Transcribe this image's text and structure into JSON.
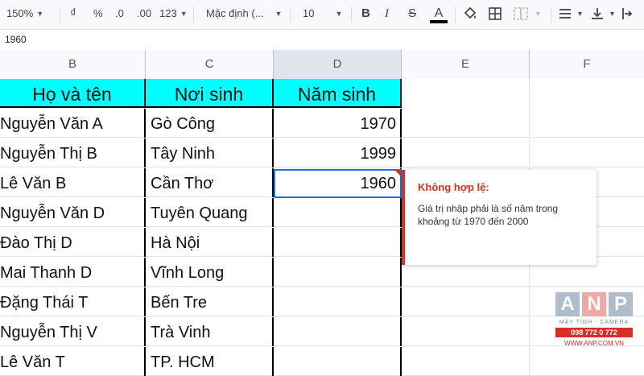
{
  "toolbar": {
    "zoom": "150%",
    "currency": "₫",
    "percent": "%",
    "dec_decrease": ".0",
    "dec_increase": ".00",
    "more_formats": "123",
    "font_name": "Mặc định (...",
    "font_size": "10",
    "bold": "B",
    "italic": "I",
    "strike": "S",
    "text_color": "A"
  },
  "formula_bar": {
    "value": "1960"
  },
  "columns": [
    "B",
    "C",
    "D",
    "E",
    "F"
  ],
  "table": {
    "headers": [
      "Họ và tên",
      "Nơi sinh",
      "Năm sinh"
    ],
    "rows": [
      [
        "Nguyễn Văn A",
        "Gò Công",
        "1970"
      ],
      [
        "Nguyễn Thị B",
        "Tây Ninh",
        "1999"
      ],
      [
        "Lê Văn B",
        "Cần Thơ",
        "1960"
      ],
      [
        "Nguyễn Văn D",
        "Tuyên Quang",
        ""
      ],
      [
        "Đào Thị D",
        "Hà Nội",
        ""
      ],
      [
        "Mai Thanh D",
        "Vĩnh Long",
        ""
      ],
      [
        "Đặng Thái T",
        "Bến Tre",
        ""
      ],
      [
        "Nguyễn Thị V",
        "Trà Vinh",
        ""
      ],
      [
        "Lê Văn T",
        "TP. HCM",
        ""
      ]
    ]
  },
  "tooltip": {
    "title": "Không hợp lệ:",
    "message": "Giá trị nhập phải là số năm trong khoảng từ 1970 đến 2000"
  },
  "logo": {
    "letters": [
      "A",
      "N",
      "P"
    ],
    "subtitle": "MÁY TÍNH - CAMERA",
    "phone": "098 772 0 772",
    "website": "WWW.ANP.COM.VN"
  },
  "colors": {
    "header_fill": "#00ffff",
    "selection": "#1a73e8",
    "error": "#d93025"
  }
}
